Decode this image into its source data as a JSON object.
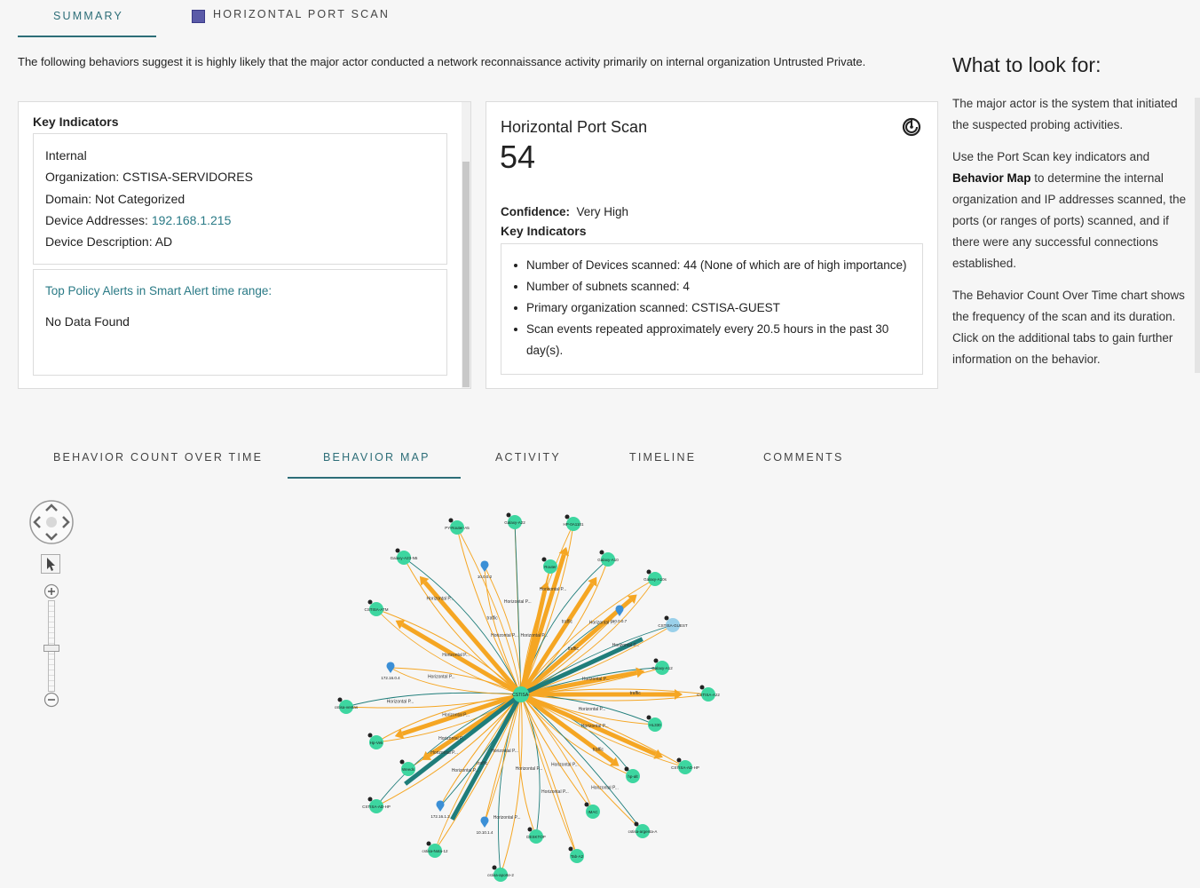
{
  "top_tabs": [
    {
      "label": "SUMMARY",
      "active": true
    },
    {
      "label": "HORIZONTAL PORT SCAN",
      "active": false,
      "swatch_color": "#5a5aa8"
    }
  ],
  "summary_sentence": "The following behaviors suggest it is highly likely that the major actor conducted a network reconnaissance activity primarily on internal organization Untrusted Private.",
  "left_panel": {
    "title": "Key Indicators",
    "details": {
      "internal": "Internal",
      "organization": "Organization: CSTISA-SERVIDORES",
      "domain": "Domain: Not Categorized",
      "device_addresses_label": "Device Addresses: ",
      "device_addresses_value": "192.168.1.215",
      "device_description": "Device Description: AD"
    },
    "policy_alerts_title": "Top Policy Alerts in Smart Alert time range:",
    "policy_alerts_value": "No Data Found"
  },
  "scan_card": {
    "title": "Horizontal Port Scan",
    "count": "54",
    "icon": "radar-icon",
    "confidence_label": "Confidence:",
    "confidence_value": "Very High",
    "key_indicators_title": "Key Indicators",
    "key_indicators": [
      "Number of Devices scanned: 44 (None of which are of high importance)",
      "Number of subnets scanned: 4",
      "Primary organization scanned: CSTISA-GUEST",
      "Scan events repeated approximately every 20.5 hours in the past 30",
      "day(s)."
    ]
  },
  "guidance": {
    "heading": "What to look for:",
    "p1": "The major actor is the system that initiated the suspected probing activities.",
    "p2_pre": "Use the Port Scan key indicators and",
    "p2_bold": "Behavior Map",
    "p2_post": "to determine the internal organization and IP addresses scanned, the ports (or ranges of ports) scanned, and if there were any successful connections established.",
    "p3": "The Behavior Count Over Time chart shows the frequency of the scan and its duration. Click on the additional tabs to gain further information on the behavior."
  },
  "bottom_tabs": [
    {
      "label": "BEHAVIOR COUNT OVER TIME",
      "active": false
    },
    {
      "label": "BEHAVIOR MAP",
      "active": true
    },
    {
      "label": "ACTIVITY",
      "active": false
    },
    {
      "label": "TIMELINE",
      "active": false
    },
    {
      "label": "COMMENTS",
      "active": false
    }
  ],
  "map_controls": [
    "pan-control-icon",
    "select-arrow-icon",
    "zoom-in-icon",
    "zoom-slider",
    "zoom-out-icon"
  ],
  "colors": {
    "accent": "#2d6e78",
    "edge_orange": "#f5a623",
    "edge_teal": "#1f7d7a",
    "node_green": "#3dd6a0",
    "node_blue": "#9ad0ea"
  },
  "map": {
    "center_label": "CSTISA-",
    "edge_label": "Horizontal P...",
    "traffic_label": "traffic",
    "nodes": [
      "PY-Router-A5",
      "Galaxy-A22",
      "HP-0A1101",
      "Galaxy-A23-N5",
      "Router",
      "Galaxy-A10",
      "Galaxy-A10s",
      "CSTISA-GUEST",
      "CSTISA-ATM",
      "Galaxy-A12",
      "CSTISA-A22",
      "cstisa-ventas",
      "Hp-Vek",
      "HL330",
      "Weeds",
      "hp-alt",
      "CSTISA-AD-HP",
      "CSTISA-AD-HP",
      "IMAC",
      "cstisa-argenta-A",
      "cstisa-Nota-12",
      "DESKTOP",
      "Tab-A2",
      "cstisa-aporte-2",
      "10.0.0.2",
      "10.0.0.7",
      "172.16.0.4",
      "172.16.1.3",
      "10.10.1.4"
    ]
  }
}
